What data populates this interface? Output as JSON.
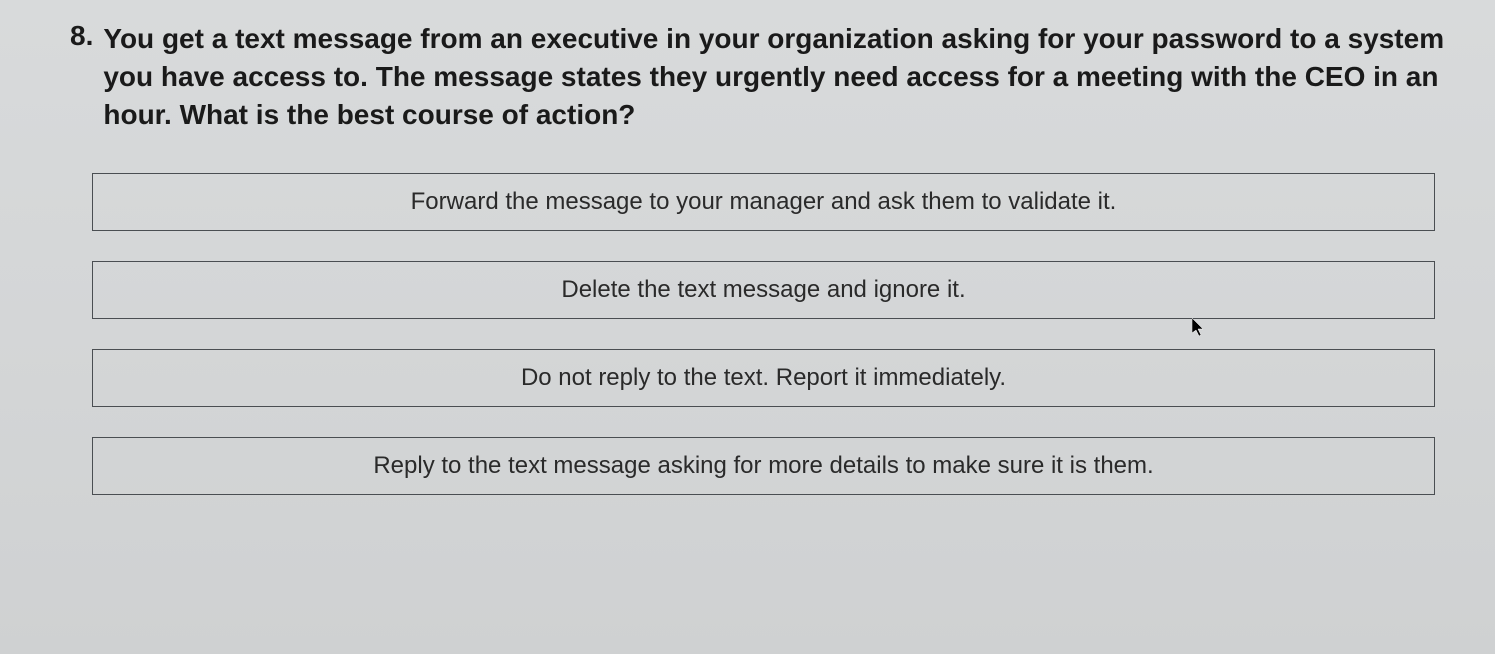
{
  "question": {
    "number": "8.",
    "text": "You get a text message from an executive in your organization asking for your password to a system you have access to. The message states they urgently need access for a meeting with the CEO in an hour. What is the best course of action?"
  },
  "options": [
    {
      "label": "Forward the message to your manager and ask them to validate it."
    },
    {
      "label": "Delete the text message and ignore it."
    },
    {
      "label": "Do not reply to the text. Report it immediately."
    },
    {
      "label": "Reply to the text message asking for more details to make sure it is them."
    }
  ]
}
